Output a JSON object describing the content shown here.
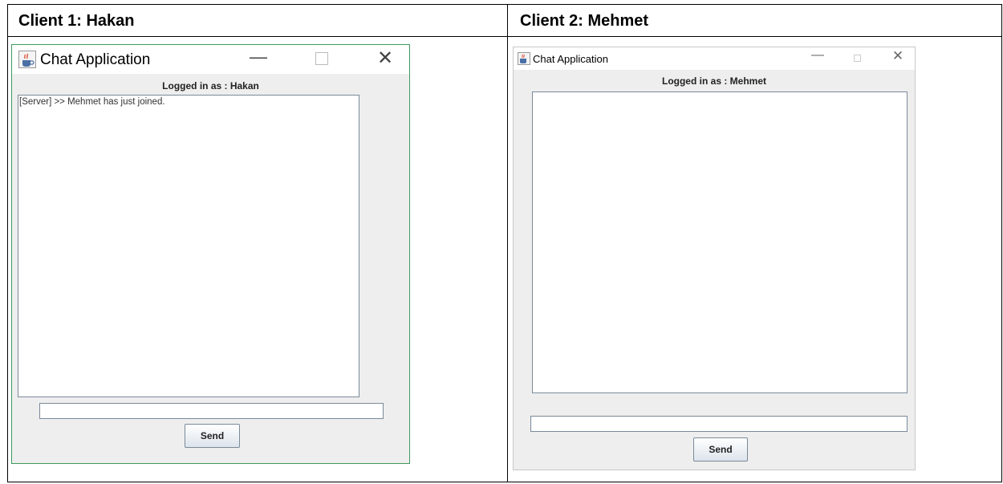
{
  "clients": [
    {
      "header": "Client 1: Hakan",
      "window": {
        "title": "Chat Application",
        "logged_in_text": "Logged in as : Hakan",
        "messages": [
          "[Server] >> Mehmet has just joined."
        ],
        "input_value": "",
        "send_label": "Send",
        "minimize_glyph": "—",
        "close_glyph": "✕"
      }
    },
    {
      "header": "Client 2: Mehmet",
      "window": {
        "title": "Chat Application",
        "logged_in_text": "Logged in as : Mehmet",
        "messages": [],
        "input_value": "",
        "send_label": "Send",
        "minimize_glyph": "—",
        "close_glyph": "✕"
      }
    }
  ],
  "icons": {
    "app": "java-coffee-cup-icon",
    "minimize": "minimize-icon",
    "maximize": "maximize-icon",
    "close": "close-icon"
  },
  "colors": {
    "window_body": "#eeeeee",
    "active_window_border": "#3f9a5c",
    "field_border": "#7a8a99"
  }
}
